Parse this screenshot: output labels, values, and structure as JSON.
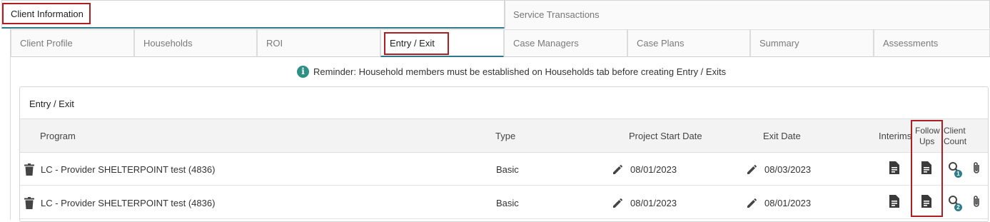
{
  "top_tabs": [
    {
      "label": "Client Information",
      "active": true
    },
    {
      "label": "Service Transactions",
      "active": false
    }
  ],
  "sub_tabs": [
    {
      "label": "Client Profile"
    },
    {
      "label": "Households"
    },
    {
      "label": "ROI"
    },
    {
      "label": "Entry / Exit",
      "active": true
    },
    {
      "label": "Case Managers"
    },
    {
      "label": "Case Plans"
    },
    {
      "label": "Summary"
    },
    {
      "label": "Assessments"
    }
  ],
  "reminder": "Reminder: Household members must be established on Households tab before creating Entry / Exits",
  "card": {
    "title": "Entry / Exit",
    "columns": {
      "program": "Program",
      "type": "Type",
      "start": "Project Start Date",
      "exit": "Exit Date",
      "interims": "Interims",
      "followups_1": "Follow",
      "followups_2": "Ups",
      "count_1": "Client",
      "count_2": "Count"
    },
    "rows": [
      {
        "program": "LC - Provider SHELTERPOINT test (4836)",
        "type": "Basic",
        "start": "08/01/2023",
        "exit": "08/03/2023",
        "count": "1"
      },
      {
        "program": "LC - Provider SHELTERPOINT test (4836)",
        "type": "Basic",
        "start": "08/01/2023",
        "exit": "08/01/2023",
        "count": "2"
      }
    ]
  },
  "colors": {
    "highlight": "#b01e23",
    "accent": "#2f7a8a",
    "icon": "#444444"
  }
}
